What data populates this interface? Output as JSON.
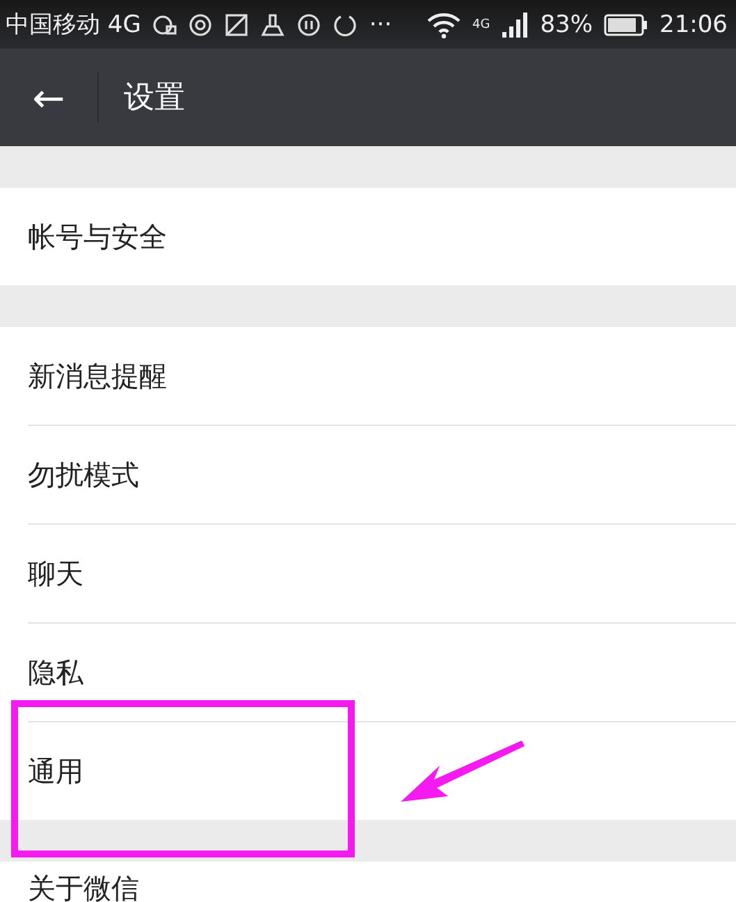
{
  "status_bar": {
    "carrier": "中国移动 4G",
    "more": "···",
    "network": "4G",
    "battery": "83%",
    "time": "21:06"
  },
  "header": {
    "back": "←",
    "title": "设置"
  },
  "groups": [
    {
      "items": [
        {
          "label": "帐号与安全"
        }
      ]
    },
    {
      "items": [
        {
          "label": "新消息提醒"
        },
        {
          "label": "勿扰模式"
        },
        {
          "label": "聊天"
        },
        {
          "label": "隐私"
        },
        {
          "label": "通用"
        }
      ]
    },
    {
      "items": [
        {
          "label": "关于微信"
        }
      ]
    }
  ]
}
